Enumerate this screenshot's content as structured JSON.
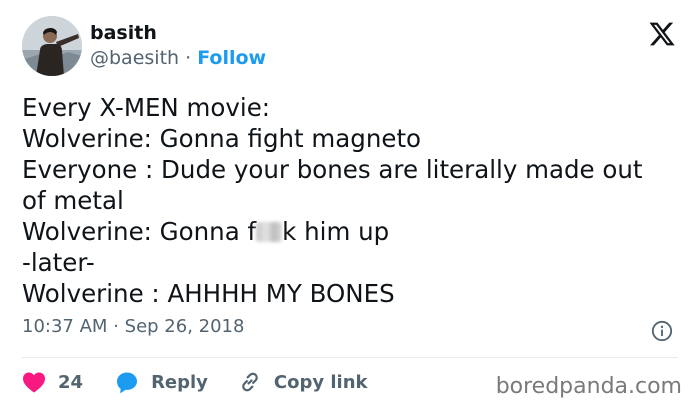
{
  "author": {
    "display_name": "basith",
    "handle": "@baesith",
    "separator": "·",
    "follow_label": "Follow"
  },
  "tweet": {
    "lines": [
      "Every X-MEN movie:",
      "Wolverine: Gonna fight magneto",
      "Everyone : Dude your bones are literally made out",
      "of metal",
      "Wolverine: Gonna f",
      "-later-",
      "Wolverine : AHHHH MY BONES"
    ],
    "censored_line_end": "k him up",
    "time": "10:37 AM",
    "date_separator": "·",
    "date": "Sep 26, 2018"
  },
  "actions": {
    "like_count": "24",
    "reply_label": "Reply",
    "copy_link_label": "Copy link"
  },
  "watermark": "boredpanda.com",
  "icons": {
    "platform": "x-logo-icon",
    "info": "info-icon",
    "like": "heart-icon",
    "reply": "reply-bubble-icon",
    "copy": "link-icon"
  },
  "colors": {
    "accent": "#1d9bf0",
    "like": "#f91880",
    "muted_text": "#536471",
    "text": "#0f1419"
  }
}
